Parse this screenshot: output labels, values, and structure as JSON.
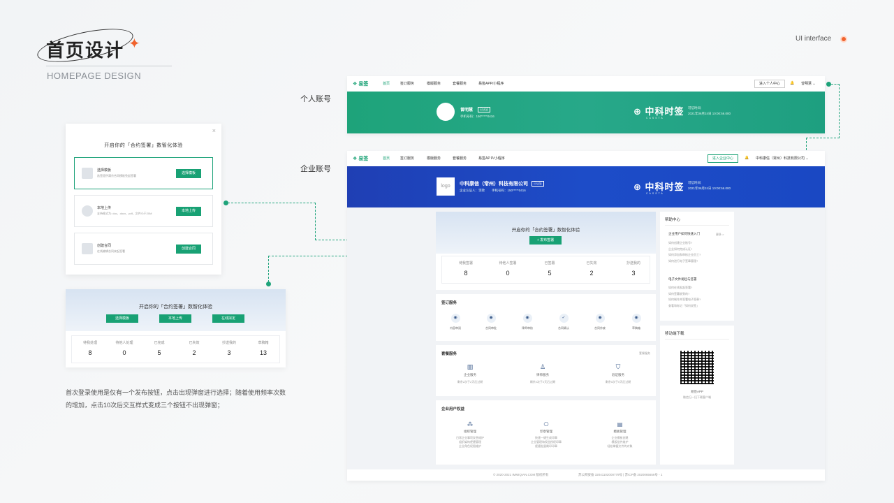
{
  "header": {
    "title": "首页设计",
    "subtitle": "HOMEPAGE DESIGN",
    "ui_tag": "UI interface"
  },
  "labels": {
    "personal": "个人账号",
    "enterprise": "企业账号"
  },
  "modal": {
    "title": "开启你的「合约签署」数智化体验",
    "close": "×",
    "options": [
      {
        "name": "选择模板",
        "desc": "选签提供满京合同模板免起签署",
        "button": "选择模板"
      },
      {
        "name": "本地上传",
        "desc": "支持格式为: doc、docx、pdf，文件小于20M",
        "button": "本地上传"
      },
      {
        "name": "创建合同",
        "desc": "在线编辑合同来起签署",
        "button": "创建合同"
      }
    ]
  },
  "dash": {
    "title": "开启你的「合约签署」数智化体验",
    "buttons": [
      "选择模板",
      "本地上传",
      "在线拟定"
    ],
    "stats": [
      {
        "label": "待我处理",
        "value": "8"
      },
      {
        "label": "待他人处理",
        "value": "0"
      },
      {
        "label": "已完成",
        "value": "5"
      },
      {
        "label": "已失效",
        "value": "2"
      },
      {
        "label": "抄送我的",
        "value": "3"
      },
      {
        "label": "草稿箱",
        "value": "13"
      }
    ]
  },
  "description": "首次登录使用是仅有一个发布按钮，点击出现弹窗进行选择；随着使用频率次数的增加，点击10次后交互样式变成三个按钮不出现弹窗；",
  "personal": {
    "logo": "易签",
    "nav": [
      "首页",
      "签订服务",
      "模版服务",
      "套餐服务",
      "易签APP/小程序"
    ],
    "switch_btn": "进入个人中心",
    "user": "曾明慧",
    "name": "曾明慧",
    "badge": "已认证",
    "phone": "手机号码：150*****0416",
    "brand": "中科时签",
    "brand_sub": "CASSTA",
    "valid_label": "可信时间:",
    "valid_time": "2021年06月24日 10:00:56.000"
  },
  "enterprise": {
    "logo": "易签",
    "nav": [
      "首页",
      "签订服务",
      "模版服务",
      "套餐服务",
      "易签AP P/小程序"
    ],
    "switch_btn": "进入企业中心",
    "company_nav": "中科康信（常州）科技有限公司",
    "logo_box": "logo",
    "company": "中科康信（常州）科技有限公司",
    "badge": "已认证",
    "contact": "企业认证人：李政",
    "phone": "手机号码：150*****0416",
    "brand": "中科时签",
    "brand_sub": "CASSTA",
    "valid_label": "可信时间:",
    "valid_time": "2021年06月24日 10:00:56.000",
    "hero_title": "开启你的「合约签署」数智化体验",
    "publish_btn": "+ 发布签署",
    "stats": [
      {
        "label": "待我签署",
        "value": "8"
      },
      {
        "label": "待他人签署",
        "value": "0"
      },
      {
        "label": "已签署",
        "value": "5"
      },
      {
        "label": "已失效",
        "value": "2"
      },
      {
        "label": "抄送我的",
        "value": "3"
      }
    ],
    "sign_service": {
      "title": "签订服务",
      "items": [
        "内容审阅",
        "合同审批",
        "律师审核",
        "合同确认",
        "合同作废",
        "草稿箱"
      ]
    },
    "package": {
      "title": "套餐服务",
      "more": "套餐服务",
      "items": [
        {
          "name": "企业服务",
          "desc": "剩余2次于2天后过期"
        },
        {
          "name": "律师服务",
          "desc": "剩余2次于2天后过期"
        },
        {
          "name": "验证服务",
          "desc": "剩余0次于0天后过期"
        }
      ]
    },
    "rights": {
      "title": "企业用户权益",
      "items": [
        {
          "name": "组织管理",
          "lines": [
            "日常企业事项发息维护",
            "组织架构便捷管理",
            "企业角色权限维护"
          ]
        },
        {
          "name": "印章管理",
          "lines": [
            "快速一键生成印章",
            "企业管理和权益授权印章",
            "便捷批量剩印印章"
          ]
        },
        {
          "name": "模板管理",
          "lines": [
            "企业模板创建",
            "模板批件维护",
            "轻松掌握文件的对象"
          ]
        }
      ]
    },
    "help": {
      "title": "帮助中心",
      "more": "更多 >",
      "section1": "企业用户如何快速入门",
      "list1": [
        "如何创建企业账号?",
        "企业如何完成认证?",
        "如何添加和审核企业员工?",
        "如何进行电子签章管理?"
      ],
      "section2": "电子文件发起与签署",
      "list2": [
        "如何在线发起签署?",
        "如何签署收到的?",
        "如何制作并签署电子签章?",
        "查看和标记「如何说签」"
      ]
    },
    "mobile": {
      "title": "移动端下载",
      "app": "易签APP",
      "hint": "微信扫一扫下载客户端"
    },
    "footer_left": "© 2020-2021 IMMIQIAN.COM 版权所有",
    "footer_right": "苏公网安备 32041102000779号 | 苏ICP备 2020065656号 - 1"
  }
}
